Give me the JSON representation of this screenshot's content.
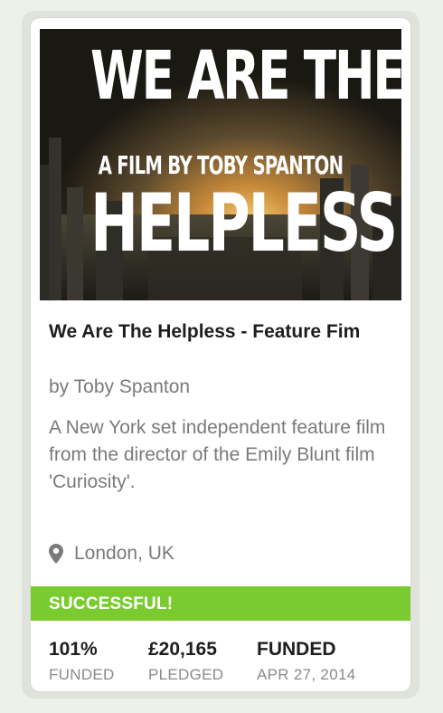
{
  "hero": {
    "line1": "WE ARE THE",
    "line2": "A FILM BY TOBY SPANTON",
    "line3": "HELPLESS"
  },
  "project": {
    "title": "We Are The Helpless - Feature Fim",
    "author": "by Toby Spanton",
    "blurb": "A New York set independent feature film from the director of the Emily Blunt film 'Curiosity'.",
    "location": "London, UK",
    "location_icon": "map-pin-icon"
  },
  "status": {
    "label": "SUCCESSFUL!",
    "color": "#7acb30"
  },
  "stats": [
    {
      "value": "101%",
      "label": "FUNDED"
    },
    {
      "value": "£20,165",
      "label": "PLEDGED"
    },
    {
      "value": "FUNDED",
      "label": "APR 27, 2014"
    }
  ]
}
